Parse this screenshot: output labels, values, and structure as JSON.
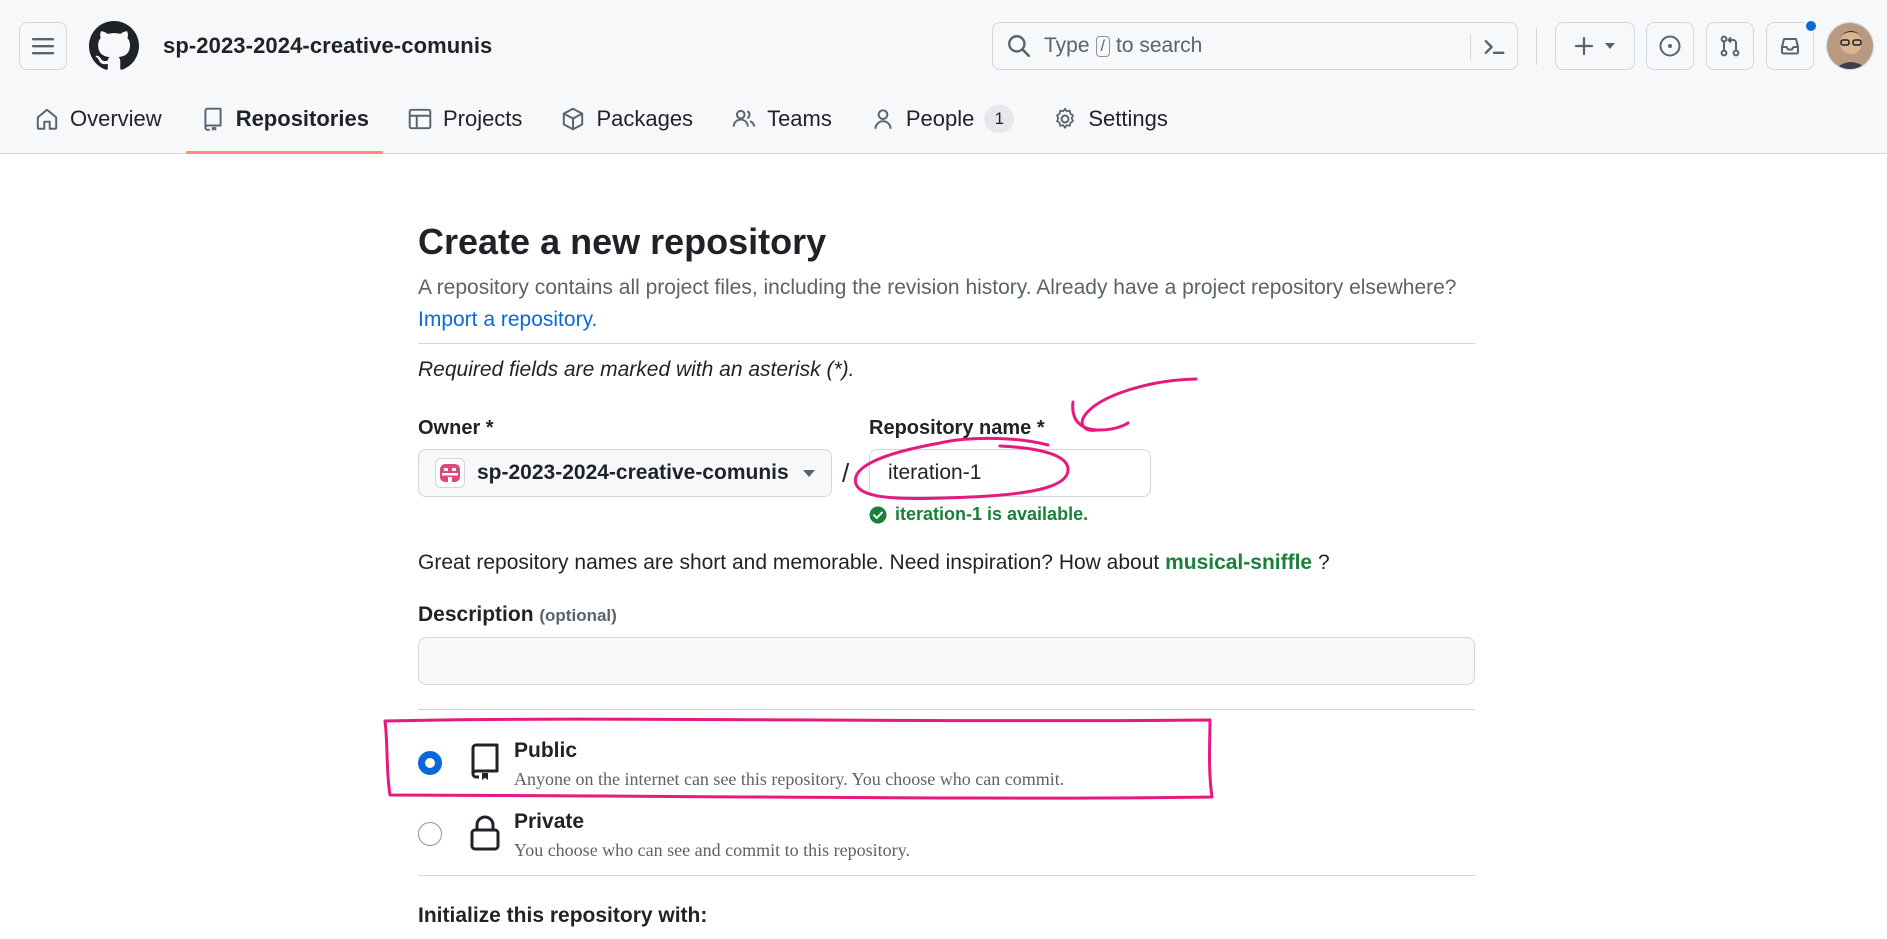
{
  "header": {
    "org_title": "sp-2023-2024-creative-comunis",
    "search": {
      "prefix": "Type",
      "key": "/",
      "suffix": "to search"
    }
  },
  "tabs": [
    {
      "label": "Overview",
      "icon": "home-icon"
    },
    {
      "label": "Repositories",
      "icon": "repo-icon",
      "active": true
    },
    {
      "label": "Projects",
      "icon": "table-icon"
    },
    {
      "label": "Packages",
      "icon": "package-icon"
    },
    {
      "label": "Teams",
      "icon": "people-icon"
    },
    {
      "label": "People",
      "icon": "person-icon",
      "count": "1"
    },
    {
      "label": "Settings",
      "icon": "gear-icon"
    }
  ],
  "form": {
    "title": "Create a new repository",
    "lead": "A repository contains all project files, including the revision history. Already have a project repository elsewhere?",
    "import_link": "Import a repository.",
    "required_note": "Required fields are marked with an asterisk (*).",
    "owner_label": "Owner *",
    "owner_value": "sp-2023-2024-creative-comunis",
    "slash": "/",
    "name_label": "Repository name *",
    "name_value": "iteration-1",
    "availability": "iteration-1 is available.",
    "hint_prefix": "Great repository names are short and memorable. Need inspiration? How about",
    "hint_suggestion": "musical-sniffle",
    "hint_suffix": "?",
    "description_label": "Description",
    "description_optional": "(optional)",
    "description_value": "",
    "visibility": [
      {
        "title": "Public",
        "desc": "Anyone on the internet can see this repository. You choose who can commit.",
        "checked": true
      },
      {
        "title": "Private",
        "desc": "You choose who can see and commit to this repository.",
        "checked": false
      }
    ],
    "init_label": "Initialize this repository with:"
  },
  "colors": {
    "accent": "#0969da",
    "success": "#1a7f37",
    "tab_underline": "#fd8c73",
    "annotation": "#e6197f"
  }
}
